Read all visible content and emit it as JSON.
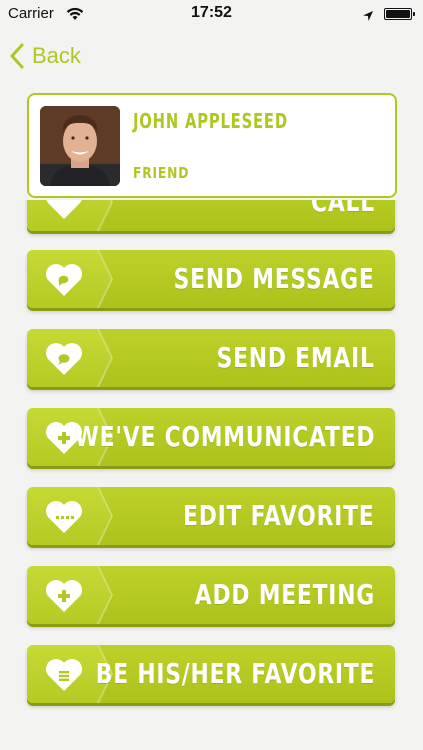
{
  "status_bar": {
    "carrier": "Carrier",
    "time": "17:52"
  },
  "nav": {
    "back_label": "Back"
  },
  "contact": {
    "name": "JOHN APPLESEED",
    "relation": "FRIEND"
  },
  "actions": [
    {
      "label": "CALL",
      "icon": "phone-heart-icon"
    },
    {
      "label": "SEND MESSAGE",
      "icon": "message-heart-icon"
    },
    {
      "label": "SEND EMAIL",
      "icon": "email-heart-icon"
    },
    {
      "label": "WE'VE COMMUNICATED",
      "icon": "plus-heart-icon"
    },
    {
      "label": "EDIT FAVORITE",
      "icon": "dots-heart-icon"
    },
    {
      "label": "ADD MEETING",
      "icon": "plus-heart-icon"
    },
    {
      "label": "BE HIS/HER FAVORITE",
      "icon": "list-heart-icon"
    }
  ],
  "colors": {
    "accent": "#b3c520",
    "button": "#b4c823",
    "button_shadow": "#8b9b12"
  }
}
